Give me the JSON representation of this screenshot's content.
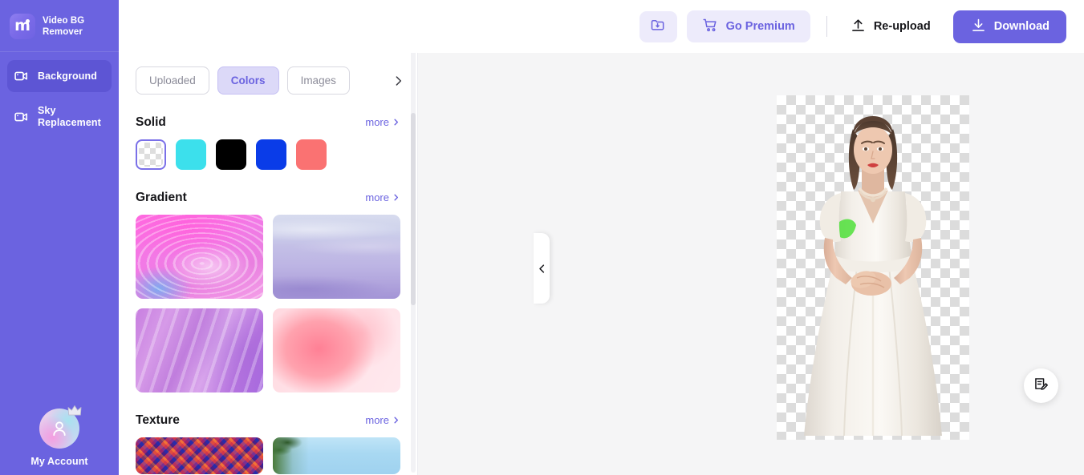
{
  "app": {
    "brand_name": "Video BG\nRemover",
    "logo_letter": "m"
  },
  "sidebar": {
    "items": [
      {
        "label": "Background",
        "icon": "video-camera-icon",
        "active": true
      },
      {
        "label": "Sky\nReplacement",
        "icon": "video-camera-icon",
        "active": false
      }
    ],
    "account": {
      "label": "My Account",
      "icon": "user-avatar-crown-icon"
    },
    "colors": {
      "background": "#6b63e0",
      "active_item": "#5d55d4"
    }
  },
  "header": {
    "folder_button": {
      "icon": "folder-download-icon",
      "label": ""
    },
    "go_premium": {
      "label": "Go Premium",
      "icon": "cart-icon"
    },
    "reupload": {
      "label": "Re-upload",
      "icon": "upload-icon"
    },
    "download": {
      "label": "Download",
      "icon": "download-icon"
    },
    "accent_color": "#6b63e0"
  },
  "panel": {
    "tabs": [
      {
        "label": "Uploaded",
        "active": false
      },
      {
        "label": "Colors",
        "active": true
      },
      {
        "label": "Images",
        "active": false
      }
    ],
    "tabs_next_icon": "chevron-right-icon",
    "sections": [
      {
        "title": "Solid",
        "more_label": "more",
        "swatches": [
          {
            "name": "transparent",
            "color": "transparent",
            "selected": true
          },
          {
            "name": "cyan",
            "color": "#3ce0ec",
            "selected": false
          },
          {
            "name": "black",
            "color": "#000000",
            "selected": false
          },
          {
            "name": "blue",
            "color": "#0a3ce8",
            "selected": false
          },
          {
            "name": "salmon",
            "color": "#fa7272",
            "selected": false
          }
        ]
      },
      {
        "title": "Gradient",
        "more_label": "more",
        "thumbs": [
          {
            "name": "pink-swirl-gradient"
          },
          {
            "name": "purple-waves-gradient"
          },
          {
            "name": "violet-silk-gradient"
          },
          {
            "name": "pink-blush-gradient"
          }
        ]
      },
      {
        "title": "Texture",
        "more_label": "more",
        "thumbs": [
          {
            "name": "mosaic-texture"
          },
          {
            "name": "palm-sky-texture"
          }
        ]
      }
    ],
    "collapse_icon": "chevron-left-icon"
  },
  "canvas": {
    "background_label": "transparent-checkerboard",
    "subject_label": "woman-in-white-dress"
  },
  "fab": {
    "icon": "feedback-edit-icon",
    "label": ""
  }
}
